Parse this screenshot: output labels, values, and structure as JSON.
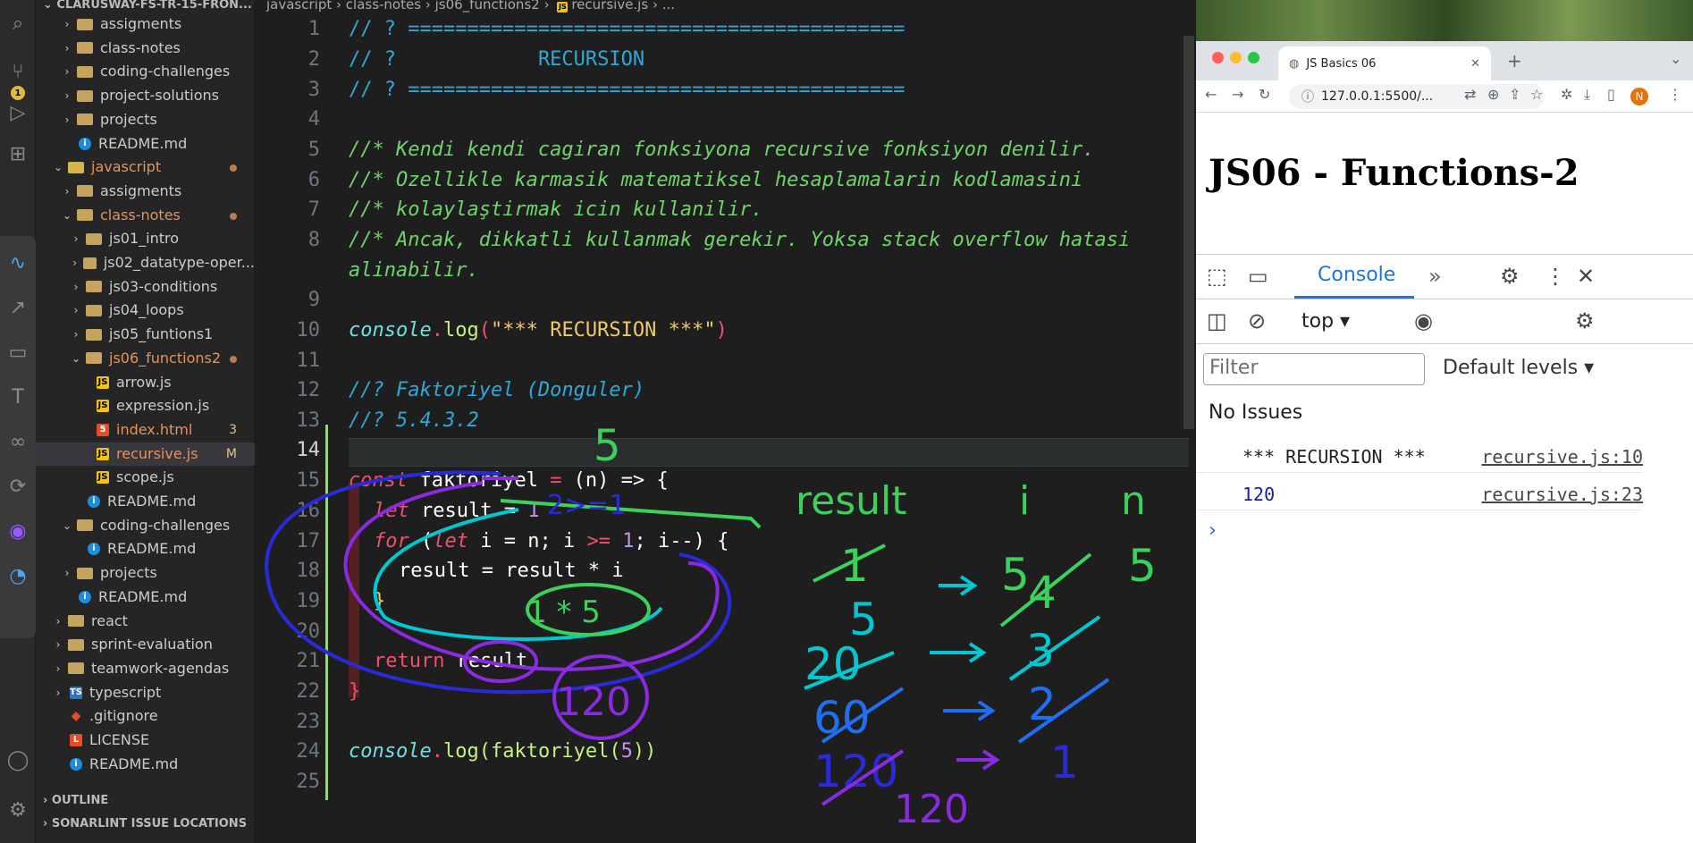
{
  "sidebar": {
    "title": "CLARUSWAY-FS-TR-15-FRON...",
    "items": [
      {
        "label": "assigments",
        "kind": "folder",
        "chev": "›"
      },
      {
        "label": "class-notes",
        "kind": "folder",
        "chev": "›"
      },
      {
        "label": "coding-challenges",
        "kind": "folder",
        "chev": "›"
      },
      {
        "label": "project-solutions",
        "kind": "folder",
        "chev": "›"
      },
      {
        "label": "projects",
        "kind": "folder",
        "chev": "›"
      },
      {
        "label": "README.md",
        "kind": "info"
      },
      {
        "label": "javascript",
        "kind": "folder-js",
        "chev": "⌄"
      },
      {
        "label": "assigments",
        "kind": "folder",
        "chev": "›"
      },
      {
        "label": "class-notes",
        "kind": "folder",
        "chev": "⌄"
      },
      {
        "label": "js01_intro",
        "kind": "folder",
        "chev": "›"
      },
      {
        "label": "js02_datatype-oper...",
        "kind": "folder",
        "chev": "›"
      },
      {
        "label": "js03-conditions",
        "kind": "folder",
        "chev": "›"
      },
      {
        "label": "js04_loops",
        "kind": "folder",
        "chev": "›"
      },
      {
        "label": "js05_funtions1",
        "kind": "folder",
        "chev": "›"
      },
      {
        "label": "js06_functions2",
        "kind": "folder",
        "chev": "⌄"
      },
      {
        "label": "arrow.js",
        "kind": "js"
      },
      {
        "label": "expression.js",
        "kind": "js"
      },
      {
        "label": "index.html",
        "kind": "html",
        "tag": "3"
      },
      {
        "label": "recursive.js",
        "kind": "js",
        "tag": "M"
      },
      {
        "label": "scope.js",
        "kind": "js"
      },
      {
        "label": "README.md",
        "kind": "info"
      },
      {
        "label": "coding-challenges",
        "kind": "folder",
        "chev": "⌄"
      },
      {
        "label": "README.md",
        "kind": "info"
      },
      {
        "label": "projects",
        "kind": "folder",
        "chev": "›"
      },
      {
        "label": "README.md",
        "kind": "info"
      },
      {
        "label": "react",
        "kind": "folder",
        "chev": "›"
      },
      {
        "label": "sprint-evaluation",
        "kind": "folder",
        "chev": "›"
      },
      {
        "label": "teamwork-agendas",
        "kind": "folder",
        "chev": "›"
      },
      {
        "label": "typescript",
        "kind": "ts",
        "chev": "›"
      },
      {
        "label": ".gitignore",
        "kind": "git"
      },
      {
        "label": "LICENSE",
        "kind": "license"
      },
      {
        "label": "README.md",
        "kind": "info"
      }
    ],
    "outline": "OUTLINE",
    "sonarlint": "SONARLINT ISSUE LOCATIONS",
    "scm_badge": "1"
  },
  "editor": {
    "breadcrumbs": [
      "javascript",
      "class-notes",
      "js06_functions2",
      "recursive.js",
      "..."
    ],
    "line_numbers": [
      "1",
      "2",
      "3",
      "4",
      "5",
      "6",
      "7",
      "8",
      "",
      "9",
      "10",
      "11",
      "12",
      "13",
      "14",
      "15",
      "16",
      "17",
      "18",
      "19",
      "20",
      "21",
      "22",
      "23",
      "24",
      "25"
    ],
    "lines": {
      "l1": "// ? ==========================================",
      "l2a": "// ?",
      "l2b": "RECURSION",
      "l3": "// ? ==========================================",
      "l5": "//* Kendi kendi cagiran fonksiyona recursive fonksiyon denilir.",
      "l6": "//* Ozellikle karmasik matematiksel hesaplamalarin kodlamasini",
      "l7": "//* kolaylaştirmak icin kullanilir.",
      "l8": "//* Ancak, dikkatli kullanmak gerekir. Yoksa stack overflow hatasi",
      "l8b": "alinabilir.",
      "l10_fn": "console",
      "l10_dot": ".",
      "l10_log": "log",
      "l10_open": "(",
      "l10_str": "\"*** RECURSION ***\"",
      "l10_close": ")",
      "l12": "//? Faktoriyel (Donguler)",
      "l13": "//? 5.4.3.2",
      "l15_kw": "const",
      "l15_name": " faktoriyel ",
      "l15_eq": "=",
      "l15_rest": " (n) => {",
      "l16_kw": "let",
      "l16_rest": " result = ",
      "l16_num": "1",
      "l17_kw": "for",
      "l17_a": " (",
      "l17_let": "let",
      "l17_b": " i = n; i ",
      "l17_op": ">=",
      "l17_c": " ",
      "l17_num": "1",
      "l17_d": "; i--) {",
      "l18": "result = result * i",
      "l19": "}",
      "l21_kw": "return",
      "l21_rest": " result",
      "l22": "}",
      "l24_fn": "console",
      "l24_dot": ".",
      "l24_log": "log",
      "l24_a": "(faktoriyel(",
      "l24_num": "5",
      "l24_b": "))"
    }
  },
  "browser": {
    "tab_title": "JS Basics 06",
    "url": "127.0.0.1:5500/...",
    "page_heading": "JS06 - Functions-2",
    "devtools": {
      "tab_console": "Console",
      "context": "top",
      "filter_placeholder": "Filter",
      "levels": "Default levels",
      "no_issues": "No Issues",
      "logs": [
        {
          "msg": "*** RECURSION ***",
          "src": "recursive.js:10",
          "color": "#202124"
        },
        {
          "msg": "120",
          "src": "recursive.js:23",
          "color": "#1a1aa6"
        }
      ]
    }
  },
  "annotations": {
    "top_five": "5",
    "col_result": "result",
    "col_i": "i",
    "col_n": "n",
    "n_value": "5",
    "result_steps": [
      "1",
      "5",
      "20",
      "60",
      "120",
      "120"
    ],
    "i_steps": [
      "5",
      "4",
      "3",
      "2",
      "1"
    ],
    "circle_product": "1 * 5",
    "circle_result": "120",
    "loop_cond": "2>=1"
  }
}
